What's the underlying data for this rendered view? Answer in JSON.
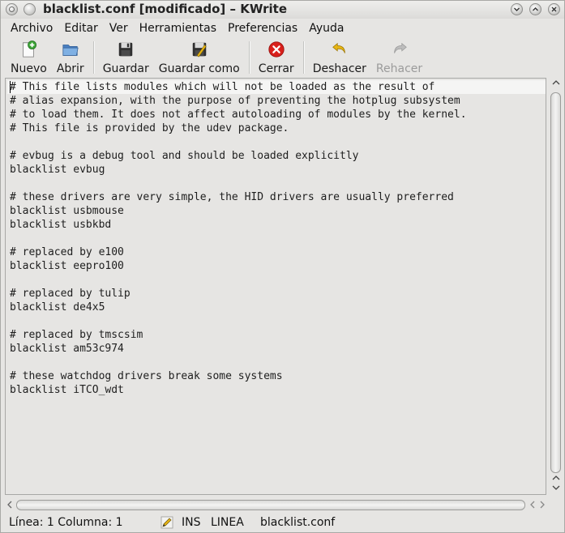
{
  "window": {
    "title": "blacklist.conf [modificado] – KWrite"
  },
  "menubar": {
    "items": [
      "Archivo",
      "Editar",
      "Ver",
      "Herramientas",
      "Preferencias",
      "Ayuda"
    ]
  },
  "toolbar": {
    "new_label": "Nuevo",
    "open_label": "Abrir",
    "save_label": "Guardar",
    "save_as_label": "Guardar como",
    "close_label": "Cerrar",
    "undo_label": "Deshacer",
    "redo_label": "Rehacer"
  },
  "editor": {
    "lines": [
      "# This file lists modules which will not be loaded as the result of",
      "# alias expansion, with the purpose of preventing the hotplug subsystem",
      "# to load them. It does not affect autoloading of modules by the kernel.",
      "# This file is provided by the udev package.",
      "",
      "# evbug is a debug tool and should be loaded explicitly",
      "blacklist evbug",
      "",
      "# these drivers are very simple, the HID drivers are usually preferred",
      "blacklist usbmouse",
      "blacklist usbkbd",
      "",
      "# replaced by e100",
      "blacklist eepro100",
      "",
      "# replaced by tulip",
      "blacklist de4x5",
      "",
      "# replaced by tmscsim",
      "blacklist am53c974",
      "",
      "# these watchdog drivers break some systems",
      "blacklist iTCO_wdt"
    ]
  },
  "statusbar": {
    "position": "Línea: 1 Columna: 1",
    "mode": "INS",
    "selection_mode": "LINEA",
    "filename": "blacklist.conf"
  },
  "colors": {
    "close_red": "#d9201b",
    "undo_yellow": "#e8b614",
    "new_green": "#3aa335",
    "open_blue": "#5b8fc9"
  }
}
